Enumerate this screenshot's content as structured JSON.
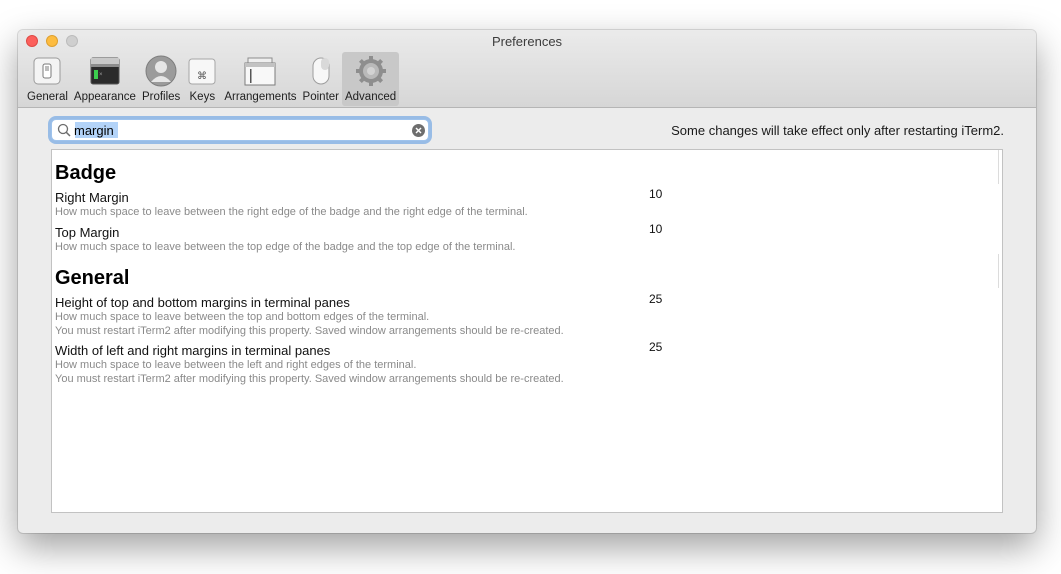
{
  "window": {
    "title": "Preferences"
  },
  "toolbar": {
    "items": [
      {
        "label": "General",
        "icon": "general-switch-icon"
      },
      {
        "label": "Appearance",
        "icon": "appearance-window-icon"
      },
      {
        "label": "Profiles",
        "icon": "profiles-person-icon"
      },
      {
        "label": "Keys",
        "icon": "keys-command-icon"
      },
      {
        "label": "Arrangements",
        "icon": "arrangements-windows-icon"
      },
      {
        "label": "Pointer",
        "icon": "pointer-mouse-icon"
      },
      {
        "label": "Advanced",
        "icon": "advanced-gear-icon",
        "selected": true
      }
    ]
  },
  "search": {
    "value": "margin",
    "placeholder": ""
  },
  "notice": "Some changes will take effect only after restarting iTerm2.",
  "sections": [
    {
      "title": "Badge",
      "settings": [
        {
          "name": "Right Margin",
          "desc": "How much space to leave between the right edge of the badge and the right edge of the terminal.",
          "value": "10"
        },
        {
          "name": "Top Margin",
          "desc": "How much space to leave between the top edge of the badge and the top edge of the terminal.",
          "value": "10"
        }
      ]
    },
    {
      "title": "General",
      "settings": [
        {
          "name": "Height of top and bottom margins in terminal panes",
          "desc": "How much space to leave between the top and bottom edges of the terminal.",
          "desc2": "You must restart iTerm2 after modifying this property. Saved window arrangements should be re-created.",
          "value": "25"
        },
        {
          "name": "Width of left and right margins in terminal panes",
          "desc": "How much space to leave between the left and right edges of the terminal.",
          "desc2": "You must restart iTerm2 after modifying this property. Saved window arrangements should be re-created.",
          "value": "25"
        }
      ]
    }
  ],
  "colors": {
    "accent": "#5396e2",
    "selection": "#b3d3f8",
    "close": "#fc605c",
    "minimize": "#fdbc40"
  }
}
